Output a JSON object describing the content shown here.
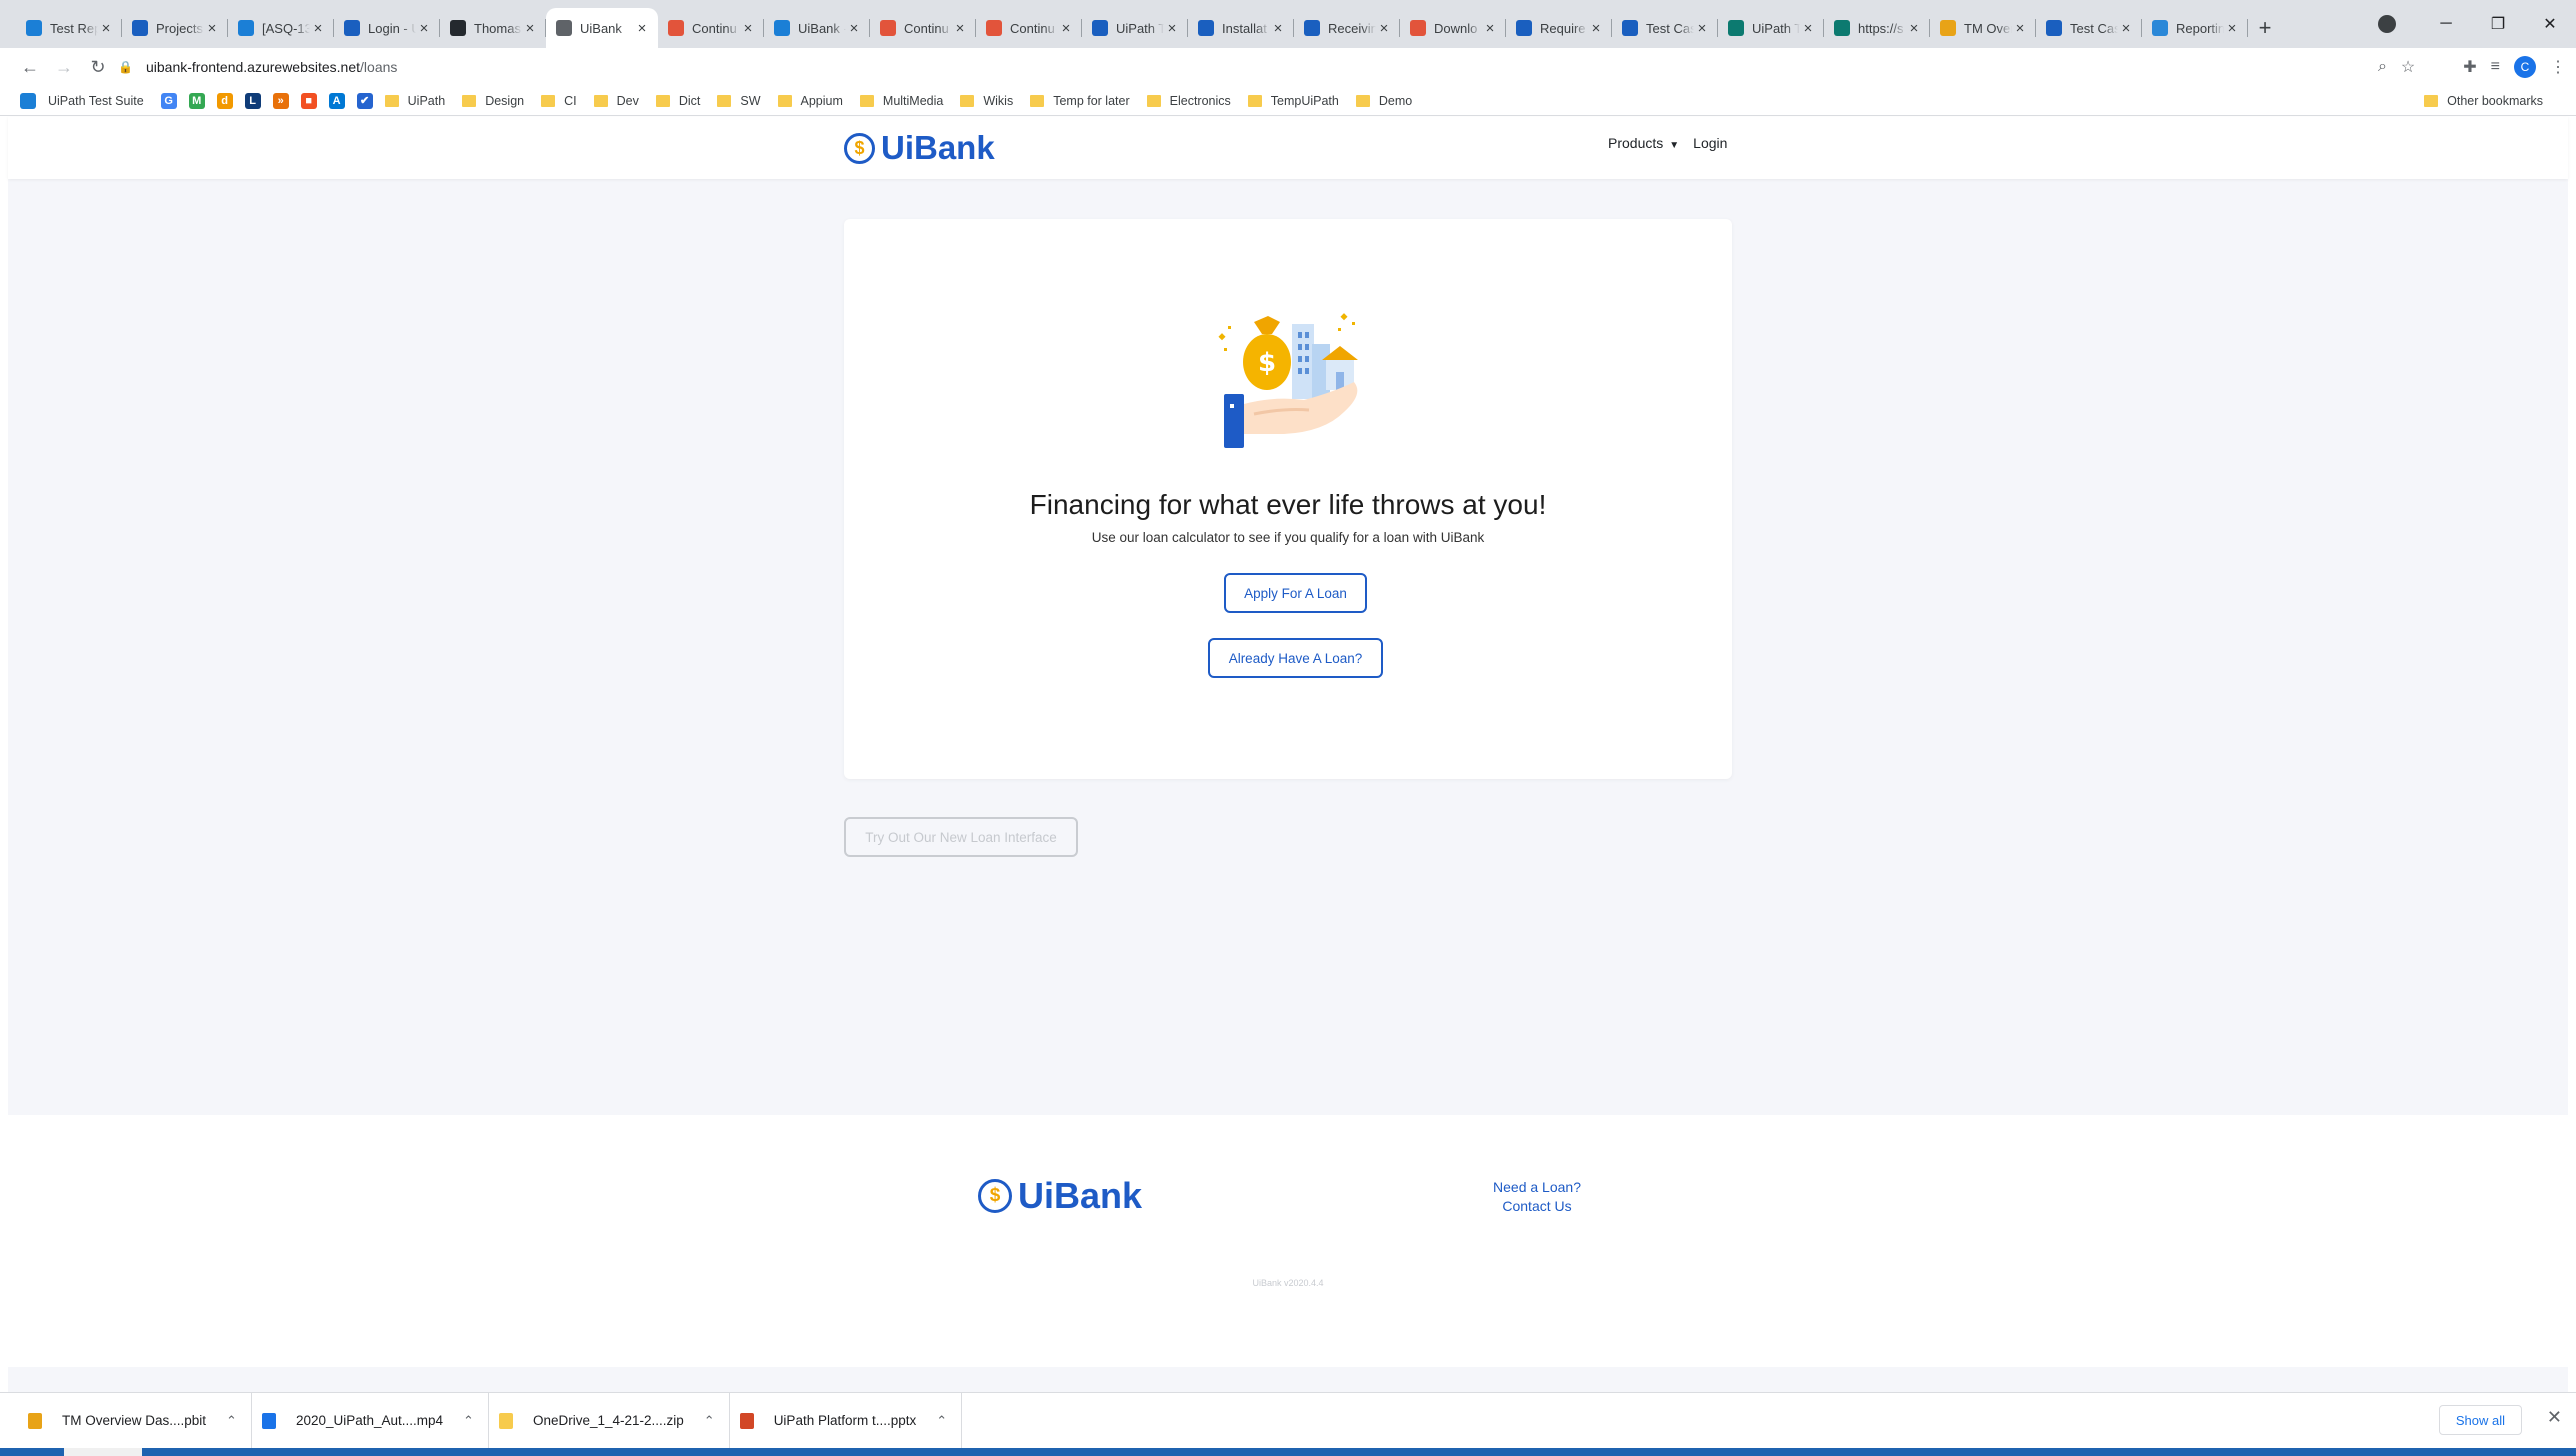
{
  "browser": {
    "tabs": [
      {
        "title": "Test Rep",
        "icon_color": "#1b7fd6",
        "icon": "diamond-icon"
      },
      {
        "title": "Projects",
        "icon_color": "#1a5fbf",
        "icon": "ui-icon"
      },
      {
        "title": "[ASQ-13",
        "icon_color": "#1b7fd6",
        "icon": "diamond-icon"
      },
      {
        "title": "Login - U",
        "icon_color": "#1a5fbf",
        "icon": "ui-icon"
      },
      {
        "title": "Thomas",
        "icon_color": "#24292e",
        "icon": "github-icon"
      },
      {
        "title": "UiBank",
        "icon_color": "#5f6368",
        "icon": "bank-icon",
        "active": true
      },
      {
        "title": "Continu",
        "icon_color": "#e2543b",
        "icon": "ui-icon"
      },
      {
        "title": "UiBank -",
        "icon_color": "#1b7fd6",
        "icon": "confluence-icon"
      },
      {
        "title": "Continu",
        "icon_color": "#e2543b",
        "icon": "ui-icon"
      },
      {
        "title": "Continu",
        "icon_color": "#e2543b",
        "icon": "ui-icon"
      },
      {
        "title": "UiPath T",
        "icon_color": "#1a5fbf",
        "icon": "ui-icon"
      },
      {
        "title": "Installat",
        "icon_color": "#1a5fbf",
        "icon": "ui-icon"
      },
      {
        "title": "Receivin",
        "icon_color": "#1a5fbf",
        "icon": "ui-icon"
      },
      {
        "title": "Downlo",
        "icon_color": "#e2543b",
        "icon": "ui-icon"
      },
      {
        "title": "Require",
        "icon_color": "#1a5fbf",
        "icon": "ui-icon"
      },
      {
        "title": "Test Cas",
        "icon_color": "#1a5fbf",
        "icon": "ui-icon"
      },
      {
        "title": "UiPath T",
        "icon_color": "#0c7a70",
        "icon": "sharepoint-icon"
      },
      {
        "title": "https://s",
        "icon_color": "#0c7a70",
        "icon": "sharepoint-icon"
      },
      {
        "title": "TM Over",
        "icon_color": "#e8a317",
        "icon": "powerbi-icon"
      },
      {
        "title": "Test Cas",
        "icon_color": "#1a5fbf",
        "icon": "ui-icon"
      },
      {
        "title": "Reportin",
        "icon_color": "#2b88d8",
        "icon": "cloud-icon"
      }
    ],
    "url_host": "uibank-frontend.azurewebsites.net",
    "url_path": "/loans",
    "profile_initial": "C",
    "bookmarks": [
      {
        "label": "UiPath Test Suite",
        "type": "app",
        "color": "#1b7fd6"
      },
      {
        "label": "",
        "type": "icon",
        "color": "#4285f4",
        "glyph": "G"
      },
      {
        "label": "",
        "type": "icon",
        "color": "#34a853",
        "glyph": "M"
      },
      {
        "label": "",
        "type": "icon",
        "color": "#f29900",
        "glyph": "d"
      },
      {
        "label": "",
        "type": "icon",
        "color": "#0f3c78",
        "glyph": "L"
      },
      {
        "label": "",
        "type": "icon",
        "color": "#e8710a",
        "glyph": "»"
      },
      {
        "label": "",
        "type": "icon",
        "color": "#f25022",
        "glyph": "■"
      },
      {
        "label": "",
        "type": "icon",
        "color": "#0078d4",
        "glyph": "A"
      },
      {
        "label": "",
        "type": "icon",
        "color": "#2564cf",
        "glyph": "✔"
      },
      {
        "label": "UiPath",
        "type": "folder"
      },
      {
        "label": "Design",
        "type": "folder"
      },
      {
        "label": "CI",
        "type": "folder"
      },
      {
        "label": "Dev",
        "type": "folder"
      },
      {
        "label": "Dict",
        "type": "folder"
      },
      {
        "label": "SW",
        "type": "folder"
      },
      {
        "label": "Appium",
        "type": "folder"
      },
      {
        "label": "MultiMedia",
        "type": "folder"
      },
      {
        "label": "Wikis",
        "type": "folder"
      },
      {
        "label": "Temp for later",
        "type": "folder"
      },
      {
        "label": "Electronics",
        "type": "folder"
      },
      {
        "label": "TempUiPath",
        "type": "folder"
      },
      {
        "label": "Demo",
        "type": "folder"
      }
    ],
    "other_bookmarks": "Other bookmarks"
  },
  "site": {
    "logo_text": "UiBank",
    "logo_symbol": "$",
    "nav_products": "Products",
    "nav_login": "Login",
    "hero_title": "Financing for what ever life throws at you!",
    "hero_subtitle": "Use our loan calculator to see if you qualify for a loan with UiBank",
    "apply_button": "Apply For A Loan",
    "have_loan_button": "Already Have A Loan?",
    "new_interface_button": "Try Out Our New Loan Interface",
    "footer_need_loan": "Need a Loan?",
    "footer_contact": "Contact Us",
    "footer_version": "UiBank v2020.4.4"
  },
  "downloads": {
    "items": [
      {
        "name": "TM Overview Das....pbit",
        "color": "#e8a317"
      },
      {
        "name": "2020_UiPath_Aut....mp4",
        "color": "#1a73e8"
      },
      {
        "name": "OneDrive_1_4-21-2....zip",
        "color": "#f7cb4d"
      },
      {
        "name": "UiPath Platform t....pptx",
        "color": "#d24726"
      }
    ],
    "show_all": "Show all"
  },
  "colors": {
    "brand_blue": "#1e5bc6",
    "coin_gold": "#f0a500",
    "page_bg": "#f5f6fa"
  }
}
